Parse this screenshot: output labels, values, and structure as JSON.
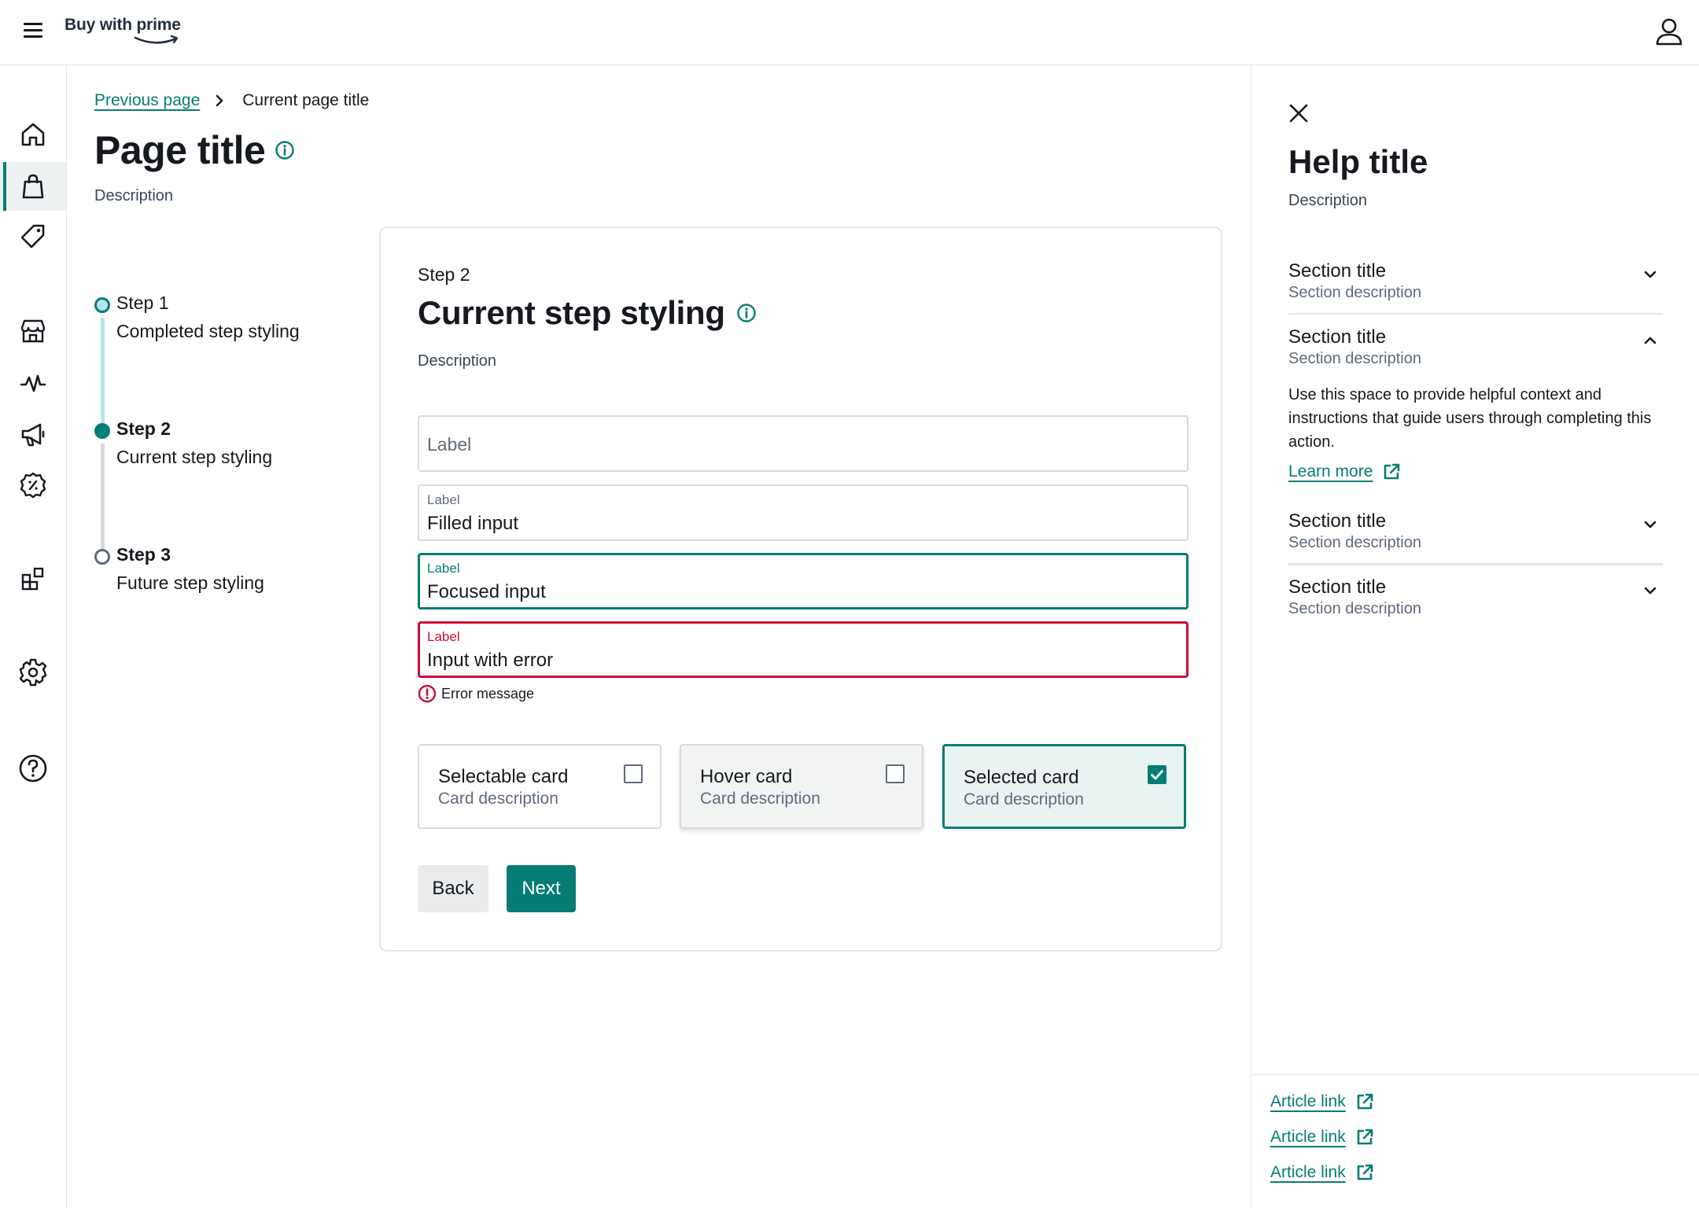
{
  "header": {
    "logo_text": "Buy with prime",
    "menu_icon": "hamburger-menu-icon",
    "user_icon": "user-account-icon"
  },
  "rail": {
    "items": [
      {
        "icon": "home-icon",
        "active": false
      },
      {
        "icon": "shopping-bag-icon",
        "active": true
      },
      {
        "icon": "price-tag-icon",
        "active": false
      },
      {
        "icon": "storefront-icon",
        "active": false
      },
      {
        "icon": "activity-pulse-icon",
        "active": false
      },
      {
        "icon": "megaphone-icon",
        "active": false
      },
      {
        "icon": "badge-percent-icon",
        "active": false
      },
      {
        "icon": "widgets-icon",
        "active": false
      },
      {
        "icon": "settings-gear-icon",
        "active": false
      },
      {
        "icon": "help-question-icon",
        "active": false
      }
    ]
  },
  "breadcrumb": {
    "previous": "Previous page",
    "current": "Current page title"
  },
  "page": {
    "title": "Page title",
    "description": "Description"
  },
  "stepper": {
    "steps": [
      {
        "title": "Step 1",
        "subtitle": "Completed step styling",
        "state": "completed"
      },
      {
        "title": "Step 2",
        "subtitle": "Current step styling",
        "state": "current"
      },
      {
        "title": "Step 3",
        "subtitle": "Future step styling",
        "state": "future"
      }
    ]
  },
  "form": {
    "step_label": "Step 2",
    "title": "Current step styling",
    "description": "Description",
    "fields": [
      {
        "state": "empty",
        "placeholder": "Label",
        "label": "",
        "value": ""
      },
      {
        "state": "filled",
        "label": "Label",
        "value": "Filled input"
      },
      {
        "state": "focused",
        "label": "Label",
        "value": "Focused input"
      },
      {
        "state": "error",
        "label": "Label",
        "value": "Input with error"
      }
    ],
    "error_message": "Error message",
    "cards": [
      {
        "title": "Selectable card",
        "description": "Card description",
        "checked": false,
        "state": "default"
      },
      {
        "title": "Hover card",
        "description": "Card description",
        "checked": false,
        "state": "hover"
      },
      {
        "title": "Selected card",
        "description": "Card description",
        "checked": true,
        "state": "selected"
      }
    ],
    "back_label": "Back",
    "next_label": "Next"
  },
  "help": {
    "title": "Help title",
    "description": "Description",
    "sections": [
      {
        "title": "Section title",
        "description": "Section description",
        "expanded": false
      },
      {
        "title": "Section title",
        "description": "Section description",
        "expanded": true
      },
      {
        "title": "Section title",
        "description": "Section description",
        "expanded": false
      },
      {
        "title": "Section title",
        "description": "Section description",
        "expanded": false
      }
    ],
    "expanded_body": "Use this space to provide helpful context and instructions that guide users through completing this action.",
    "learn_more": "Learn more",
    "article_links": [
      "Article link",
      "Article link",
      "Article link"
    ]
  },
  "colors": {
    "accent": "#067d74",
    "error": "#cc0c39",
    "text": "#16191f",
    "muted": "#5f6b7a",
    "border": "#e3e6e8",
    "completed_step": "#b9e4ea"
  }
}
